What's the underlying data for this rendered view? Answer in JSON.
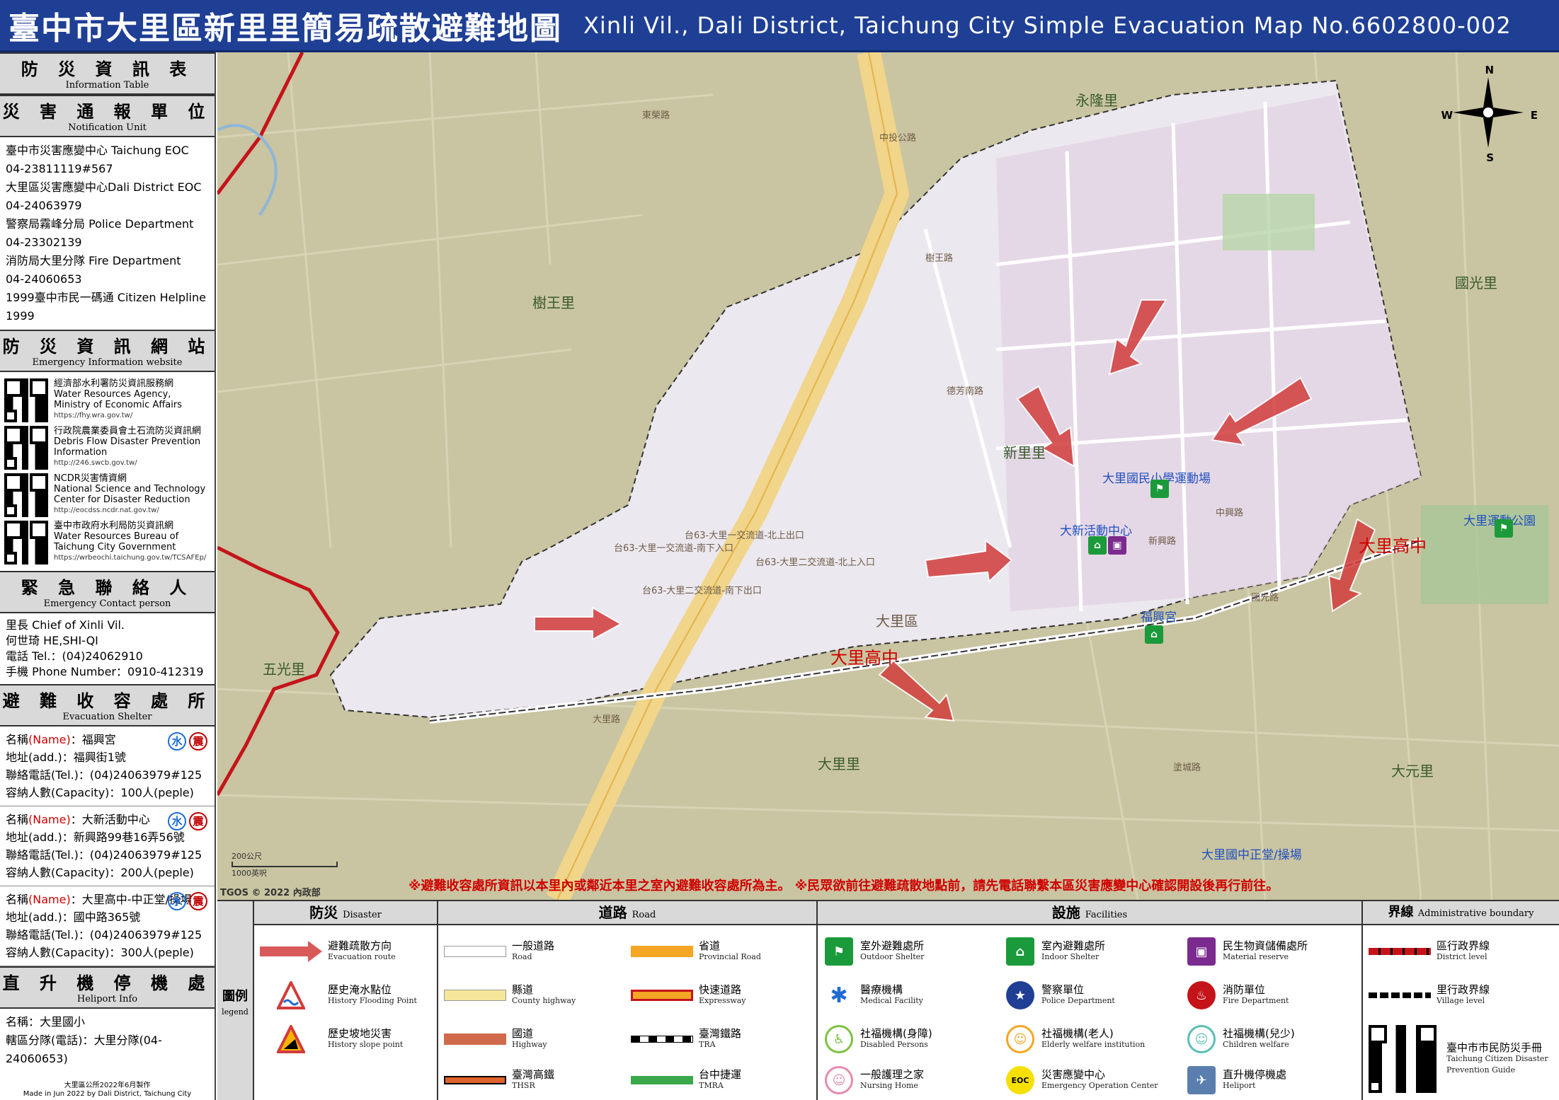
{
  "title": {
    "zh": "臺中市大里區新里里簡易疏散避難地圖",
    "en": "Xinli Vil., Dali District, Taichung City Simple Evacuation Map No.6602800-002"
  },
  "left_panel": {
    "info_table": {
      "zh": "防 災 資 訊 表",
      "en": "Information Table"
    },
    "notification": {
      "zh": "災 害 通 報 單 位",
      "en": "Notification Unit",
      "lines": [
        "臺中市災害應變中心 Taichung EOC",
        "04-23811119#567",
        "大里區災害應變中心Dali District EOC",
        "04-24063979",
        "警察局霧峰分局 Police Department",
        "04-23302139",
        "消防局大里分隊 Fire Department",
        "04-24060653",
        "1999臺中市民一碼通 Citizen Helpline",
        "1999"
      ]
    },
    "websites": {
      "zh": "防 災 資 訊 網 站",
      "en": "Emergency Information website",
      "items": [
        {
          "zh": "經濟部水利署防災資訊服務網",
          "en": "Water Resources Agency, Ministry of Economic Affairs",
          "url": "https://fhy.wra.gov.tw/"
        },
        {
          "zh": "行政院農業委員會土石流防災資訊網",
          "en": "Debris Flow Disaster Prevention Information",
          "url": "http://246.swcb.gov.tw/"
        },
        {
          "zh": "NCDR災害情資網",
          "en": "National Science and Technology Center for Disaster Reduction",
          "url": "http://eocdss.ncdr.nat.gov.tw/"
        },
        {
          "zh": "臺中市政府水利局防災資訊網",
          "en": "Water Resources Bureau of Taichung City Government",
          "url": "https://wrbeochi.taichung.gov.tw/TCSAFEp/"
        }
      ]
    },
    "contact": {
      "zh": "緊 急 聯 絡 人",
      "en": "Emergency Contact person",
      "lines": [
        "里長 Chief of Xinli Vil.",
        "何世琦 HE,SHI-QI",
        "電話 Tel.：(04)24062910",
        "手機 Phone Number：0910-412319"
      ]
    },
    "shelters": {
      "zh": "避 難 收 容 處 所",
      "en": "Evacuation Shelter",
      "name_label": "名稱",
      "name_en": "(Name)",
      "addr_label": "地址(add.)：",
      "tel_label": "聯絡電話(Tel.)：",
      "cap_label": "容納人數(Capacity)：",
      "water_glyph": "水",
      "quake_glyph": "震",
      "items": [
        {
          "name": "：福興宮",
          "addr": "福興街1號",
          "tel": "(04)24063979#125",
          "cap": "100人(peple)"
        },
        {
          "name": "：大新活動中心",
          "addr": "新興路99巷16弄56號",
          "tel": "(04)24063979#125",
          "cap": "200人(peple)"
        },
        {
          "name": "：大里高中-中正堂/操場",
          "addr": "國中路365號",
          "tel": "(04)24063979#125",
          "cap": "300人(peple)"
        }
      ]
    },
    "heliport": {
      "zh": "直 升 機 停 機 處",
      "en": "Heliport Info",
      "lines": [
        "名稱：大里國小",
        "轄區分隊(電話)：大里分隊(04-24060653)"
      ]
    },
    "footer": [
      "大里區公所2022年6月製作",
      "Made in Jun 2022 by Dali District, Taichung City"
    ]
  },
  "map": {
    "districts": [
      "樹王里",
      "五光里",
      "新里里",
      "大里區",
      "大里里",
      "永隆里",
      "國光里",
      "大元里"
    ],
    "evac_targets": [
      "大里高中",
      "大里高中"
    ],
    "places": [
      "大里國民小學運動場",
      "大新活動中心",
      "福興宮",
      "大里運動公園",
      "大里國中正堂/操場"
    ],
    "roads": [
      "中投公路",
      "大里路",
      "德芳南路",
      "國光路",
      "東榮路",
      "中興路",
      "塗城路",
      "新興路",
      "樹王路"
    ],
    "interchanges": [
      "台63-大里一交流道-北上出口",
      "台63-大里一交流道-南下入口",
      "台63-大里二交流道-北上入口",
      "台63-大里二交流道-南下出口"
    ],
    "scale": {
      "top": "200公尺",
      "bottom": "1000英呎"
    },
    "copyright": "TGOS © 2022 內政部",
    "notice": "※避難收容處所資訊以本里內或鄰近本里之室內避難收容處所為主。 ※民眾欲前往避難疏散地點前，請先電話聯繫本區災害應變中心確認開設後再行前往。",
    "compass": {
      "n": "N",
      "s": "S",
      "e": "E",
      "w": "W"
    }
  },
  "legend": {
    "side": {
      "zh": "圖例",
      "en": "legend"
    },
    "groups": [
      {
        "zh": "防災",
        "en": "Disaster",
        "items": [
          {
            "zh": "避難疏散方向",
            "en": "Evacuation route"
          },
          {
            "zh": "歷史淹水點位",
            "en": "History Flooding Point"
          },
          {
            "zh": "歷史坡地災害",
            "en": "History slope point"
          }
        ]
      },
      {
        "zh": "道路",
        "en": "Road",
        "items": [
          {
            "zh": "一般道路",
            "en": "Road"
          },
          {
            "zh": "縣道",
            "en": "County highway"
          },
          {
            "zh": "國道",
            "en": "Highway"
          },
          {
            "zh": "臺灣高鐵",
            "en": "THSR"
          },
          {
            "zh": "省道",
            "en": "Provincial Road"
          },
          {
            "zh": "快速道路",
            "en": "Expressway"
          },
          {
            "zh": "臺灣鐵路",
            "en": "TRA"
          },
          {
            "zh": "台中捷運",
            "en": "TMRA"
          }
        ]
      },
      {
        "zh": "設施",
        "en": "Facilities",
        "items": [
          {
            "zh": "室外避難處所",
            "en": "Outdoor Shelter"
          },
          {
            "zh": "醫療機構",
            "en": "Medical Facility"
          },
          {
            "zh": "社福機構(身障)",
            "en": "Disabled Persons"
          },
          {
            "zh": "一般護理之家",
            "en": "Nursing Home"
          },
          {
            "zh": "室內避難處所",
            "en": "Indoor Shelter"
          },
          {
            "zh": "警察單位",
            "en": "Police Department"
          },
          {
            "zh": "社福機構(老人)",
            "en": "Elderly welfare institution"
          },
          {
            "zh": "災害應變中心",
            "en": "Emergency Operation Center"
          },
          {
            "zh": "民生物資儲備處所",
            "en": "Material reserve"
          },
          {
            "zh": "消防單位",
            "en": "Fire Department"
          },
          {
            "zh": "社福機構(兒少)",
            "en": "Children welfare"
          },
          {
            "zh": "直升機停機處",
            "en": "Heliport"
          }
        ]
      },
      {
        "zh": "界線",
        "en": "Administrative boundary",
        "items": [
          {
            "zh": "區行政界線",
            "en": "District level"
          },
          {
            "zh": "里行政界線",
            "en": "Village level"
          }
        ]
      }
    ],
    "eoc_glyph": "EOC",
    "qr_caption": {
      "zh": "臺中市市民防災手冊",
      "en": "Taichung Citizen Disaster Prevention Guide"
    }
  },
  "colors": {
    "title_bg": "#1f3f95",
    "map_bg": "#c9c4a1",
    "village_area": "#ece8ef",
    "evac_arrow": "#d23c3c",
    "district_boundary": "#c4141a",
    "expressway": "#f0d58a"
  }
}
